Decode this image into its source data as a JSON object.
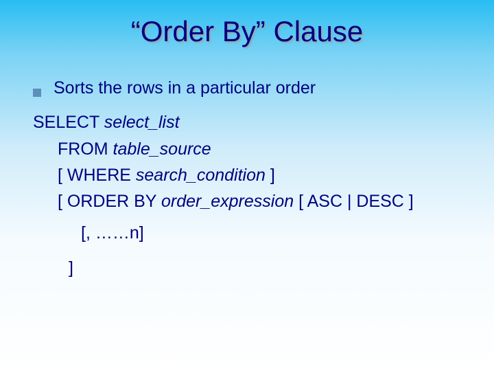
{
  "title": "“Order By” Clause",
  "bullet": "Sorts the rows in a particular order",
  "syntax": {
    "l1a": "SELECT ",
    "l1b": "select_list",
    "l2a": "FROM ",
    "l2b": "table_source",
    "l3a": "[ WHERE ",
    "l3b": "search_condition ",
    "l3c": "]",
    "l4a": "[ ORDER BY ",
    "l4b": "order_expression ",
    "l4c": "[ ASC | DESC ]",
    "l5": "[, ……n]",
    "l6": "]"
  }
}
